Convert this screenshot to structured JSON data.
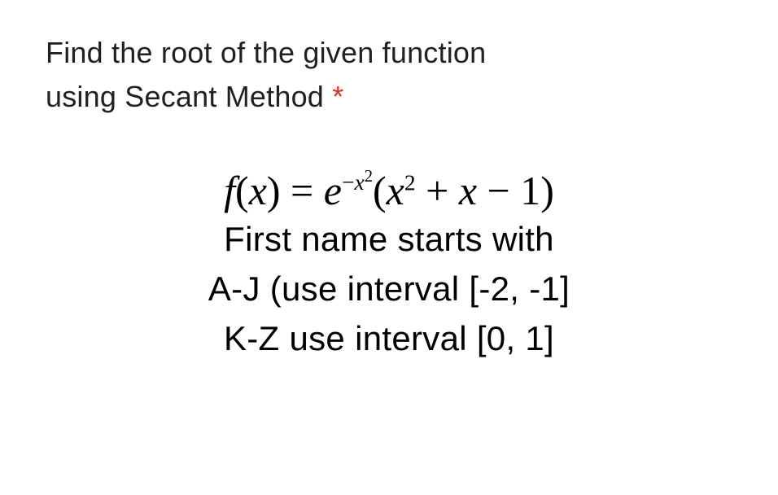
{
  "question": {
    "line1": "Find the root of the given function",
    "line2_prefix": "using Secant Method ",
    "required_mark": "*"
  },
  "formula": {
    "lhs_var": "f",
    "lhs_paren_open": "(",
    "lhs_arg": "x",
    "lhs_paren_close": ")",
    "equals": " = ",
    "e": "e",
    "exp_minus": "−",
    "exp_var": "x",
    "exp_power": "2",
    "paren_open": "(",
    "term1_var": "x",
    "term1_power": "2",
    "plus": " + ",
    "term2": "x",
    "minus": " − ",
    "term3": "1",
    "paren_close": ")"
  },
  "instructions": {
    "line1": "First name starts with",
    "line2": "A-J (use interval [-2, -1]",
    "line3": "K-Z use interval [0, 1]"
  }
}
